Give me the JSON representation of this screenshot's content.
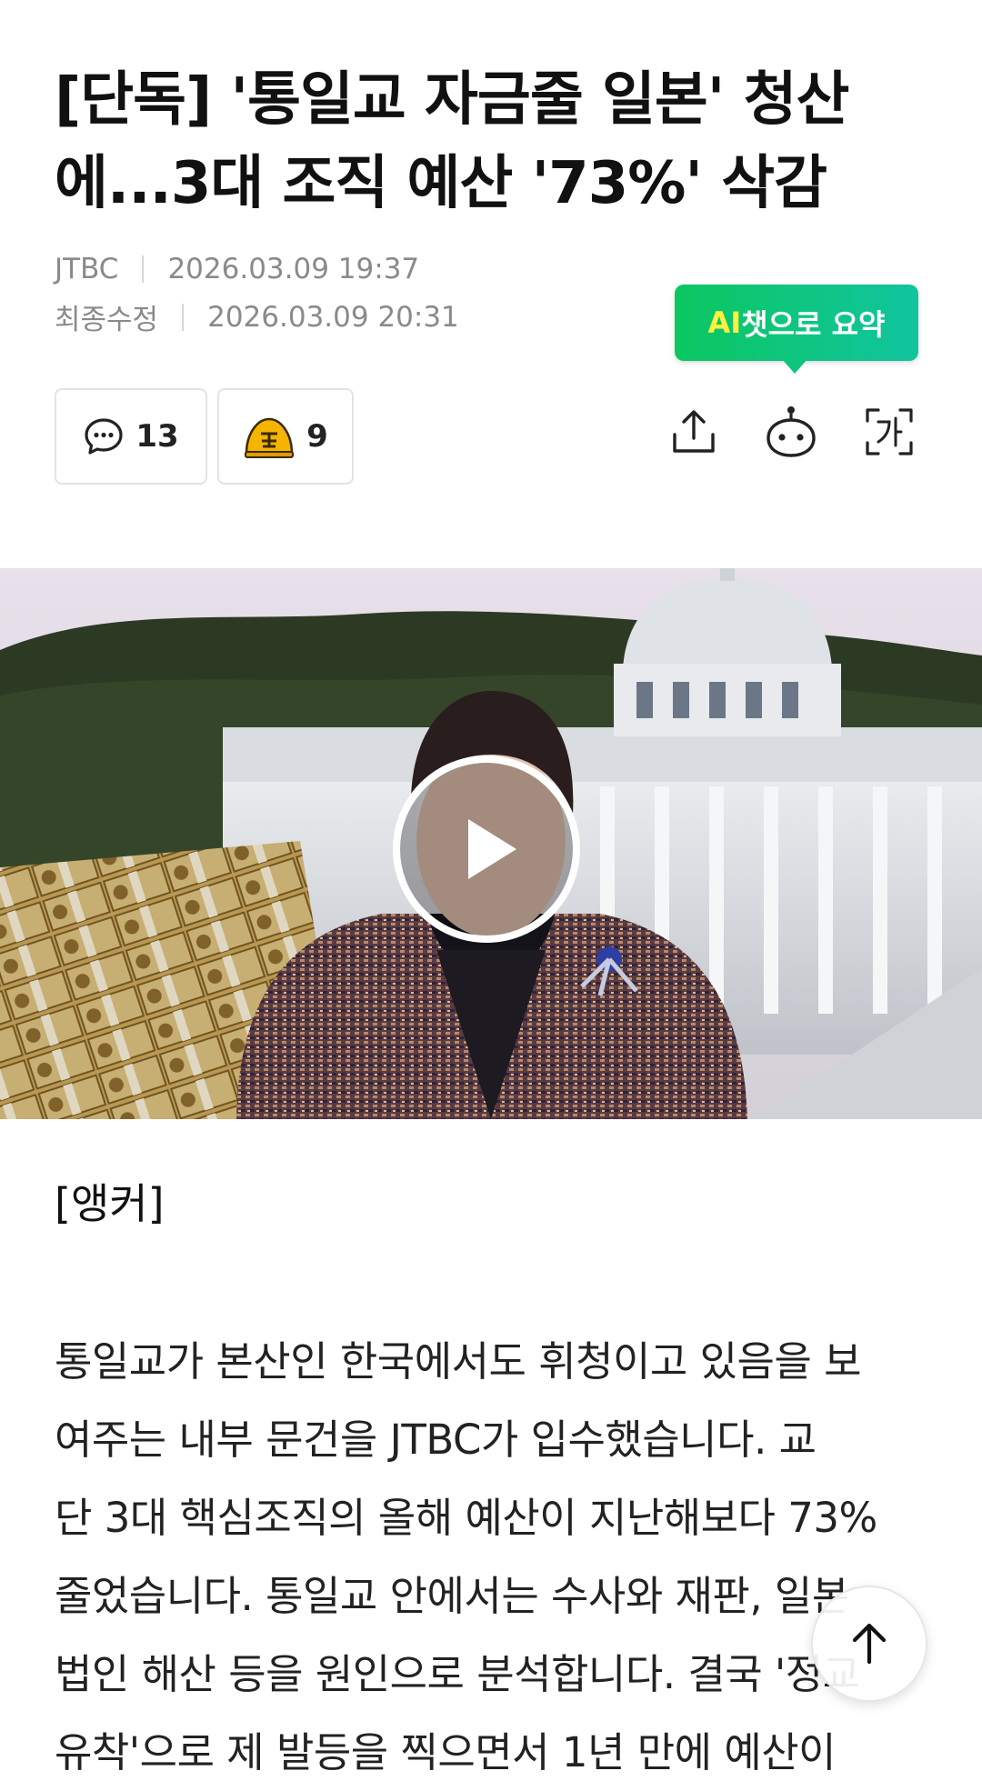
{
  "article": {
    "headline_line1": "[단독] '통일교 자금줄 일본' 청산",
    "headline_line2": "에...3대 조직 예산 '73%' 삭감",
    "press": "JTBC",
    "published": "2026.03.09 19:37",
    "modified_label": "최종수정",
    "modified": "2026.03.09 20:31"
  },
  "ai_summary": {
    "prefix": "AI",
    "rest": "챗으로 요약"
  },
  "actions": {
    "comment_count": "13",
    "reaction_count": "9",
    "share_icon": "share-icon",
    "bot_icon": "chatbot-icon",
    "font_icon": "font-size-icon"
  },
  "video": {
    "play_icon": "play-icon"
  },
  "content": {
    "label": "[앵커]",
    "lines": [
      "통일교가 본산인 한국에서도 휘청이고 있음을 보",
      "여주는 내부 문건을 JTBC가 입수했습니다. 교",
      "단 3대 핵심조직의 올해 예산이 지난해보다 73%",
      "줄었습니다. 통일교 안에서는 수사와 재판, 일본",
      "법인 해산 등을 원인으로 분석합니다. 결국 '정교",
      "유착'으로 제 발등을 찍으면서 1년 만에 예산이"
    ]
  },
  "scroll_top": {
    "icon": "arrow-up-icon"
  },
  "colors": {
    "ai_gradient_start": "#0bc760",
    "ai_gradient_end": "#11c4a0",
    "ai_highlight": "#fff23d"
  }
}
